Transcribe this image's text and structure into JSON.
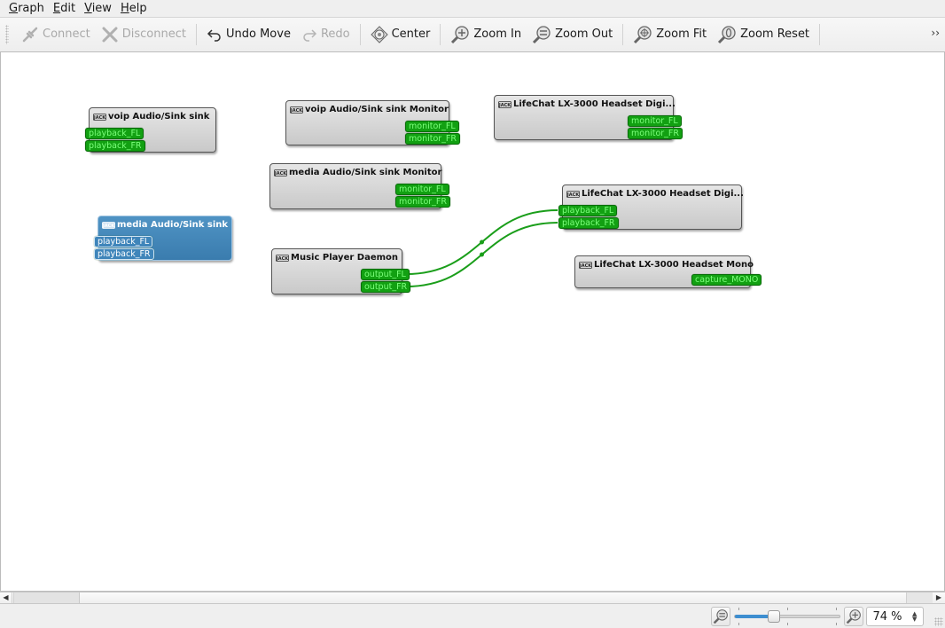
{
  "menubar": {
    "items": [
      {
        "label": "Graph",
        "mnemonic": "G",
        "rest": "raph"
      },
      {
        "label": "Edit",
        "mnemonic": "E",
        "rest": "dit"
      },
      {
        "label": "View",
        "mnemonic": "V",
        "rest": "iew"
      },
      {
        "label": "Help",
        "mnemonic": "H",
        "rest": "elp"
      }
    ]
  },
  "toolbar": {
    "connect": {
      "label": "Connect",
      "icon": "connect-icon",
      "enabled": false
    },
    "disconnect": {
      "label": "Disconnect",
      "icon": "disconnect-icon",
      "enabled": false
    },
    "undo": {
      "label": "Undo Move",
      "icon": "undo-icon",
      "enabled": true
    },
    "redo": {
      "label": "Redo",
      "icon": "redo-icon",
      "enabled": false
    },
    "center": {
      "label": "Center",
      "icon": "center-icon",
      "enabled": true
    },
    "zoom_in": {
      "label": "Zoom In",
      "icon": "zoom-in-icon",
      "enabled": true
    },
    "zoom_out": {
      "label": "Zoom Out",
      "icon": "zoom-out-icon",
      "enabled": true
    },
    "zoom_fit": {
      "label": "Zoom Fit",
      "icon": "zoom-fit-icon",
      "enabled": true
    },
    "zoom_reset": {
      "label": "Zoom Reset",
      "icon": "zoom-reset-icon",
      "enabled": true
    },
    "overflow": "››"
  },
  "graph": {
    "nodes": [
      {
        "id": "voip-sink",
        "title": "voip Audio/Sink sink",
        "ports": [
          "playback_FL",
          "playback_FR"
        ],
        "selected": false
      },
      {
        "id": "voip-monitor",
        "title": "voip Audio/Sink sink Monitor",
        "ports": [
          "monitor_FL",
          "monitor_FR"
        ],
        "selected": false
      },
      {
        "id": "lifechat-digi-1",
        "title": "LifeChat LX-3000 Headset Digi...",
        "ports": [
          "monitor_FL",
          "monitor_FR"
        ],
        "selected": false
      },
      {
        "id": "media-monitor",
        "title": "media Audio/Sink sink Monitor",
        "ports": [
          "monitor_FL",
          "monitor_FR"
        ],
        "selected": false
      },
      {
        "id": "media-sink",
        "title": "media Audio/Sink sink",
        "ports": [
          "playback_FL",
          "playback_FR"
        ],
        "selected": true
      },
      {
        "id": "lifechat-digi-2",
        "title": "LifeChat LX-3000 Headset Digi...",
        "ports": [
          "playback_FL",
          "playback_FR"
        ],
        "selected": false
      },
      {
        "id": "mpd",
        "title": "Music Player Daemon",
        "ports": [
          "output_FL",
          "output_FR"
        ],
        "selected": false
      },
      {
        "id": "lifechat-mono",
        "title": "LifeChat LX-3000 Headset Mono",
        "ports": [
          "capture_MONO"
        ],
        "selected": false
      }
    ],
    "connections": [
      {
        "from": "Music Player Daemon:output_FL",
        "to": "LifeChat LX-3000 Headset Digi...:playback_FL"
      },
      {
        "from": "Music Player Daemon:output_FR",
        "to": "LifeChat LX-3000 Headset Digi...:playback_FR"
      }
    ],
    "colors": {
      "port": "#12a012",
      "port_text": "#7cff7c",
      "wire": "#1a9e1a",
      "selected": "#3f85ba"
    }
  },
  "statusbar": {
    "zoom_value": "74 %",
    "zoom_percent": 74,
    "slider_fraction": 0.37
  }
}
